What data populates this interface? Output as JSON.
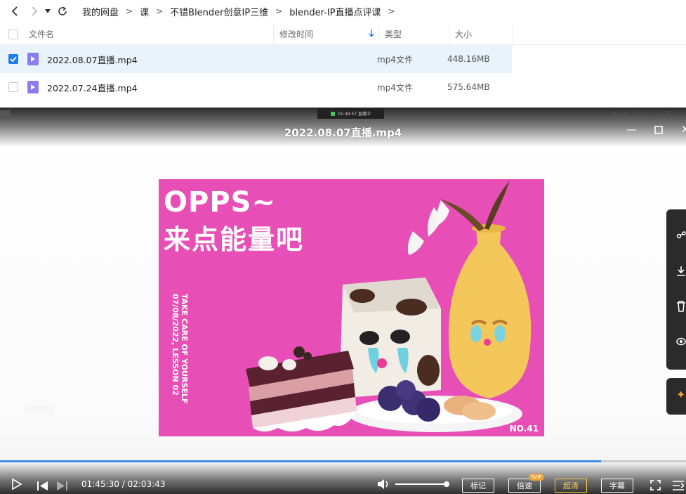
{
  "nav": {
    "breadcrumbs": [
      "我的网盘",
      "课",
      "不错Blender创意IP三维",
      "blender-IP直播点评课"
    ],
    "separator": ">"
  },
  "table": {
    "headers": {
      "name": "文件名",
      "modified": "修改时间",
      "type": "类型",
      "size": "大小"
    },
    "rows": [
      {
        "name": "2022.08.07直播.mp4",
        "type": "mp4文件",
        "size": "448.16MB",
        "selected": true
      },
      {
        "name": "2022.07.24直播.mp4",
        "type": "mp4文件",
        "size": "575.64MB",
        "selected": false
      }
    ]
  },
  "player": {
    "title": "2022.08.07直播.mp4",
    "live_pill": "01:49:57 直播中",
    "poster": {
      "line1": "OPPS~",
      "line2": "来点能量吧",
      "vertical_text": "TAKE CARE OF YOURSELF 07/08/2022, LESSON 02",
      "number": "NO.41"
    },
    "time_current": "01:45:30",
    "time_total": "02:03:43",
    "time_sep": " / ",
    "progress_fraction": 0.876,
    "volume_fraction": 0.96,
    "buttons": {
      "mark": "标记",
      "speed": "倍速",
      "speed_badge": "SVIP",
      "quality": "超清",
      "subtitle": "字幕"
    }
  },
  "colors": {
    "accent": "#1e7ee8",
    "selected_row": "#e9f3fc",
    "poster_bg": "#e84fb6",
    "quality_active": "#f3c44b"
  }
}
